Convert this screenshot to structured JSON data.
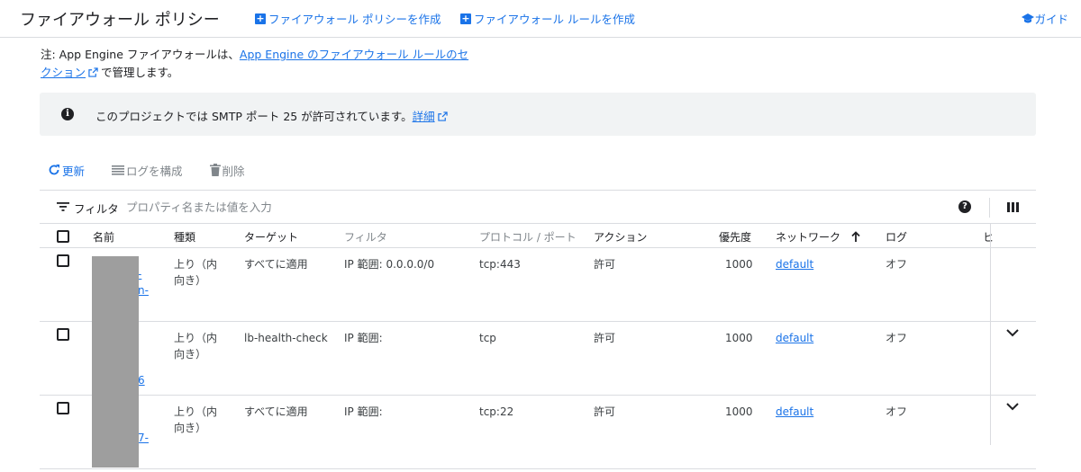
{
  "header": {
    "title": "ファイアウォール ポリシー",
    "create_policy": "ファイアウォール ポリシーを作成",
    "create_rule": "ファイアウォール ルールを作成",
    "guide": "ガイド"
  },
  "note": {
    "prefix": "注: App Engine ファイアウォールは、",
    "link": "App Engine のファイアウォール ルールのセクション",
    "suffix": "で管理します。"
  },
  "banner": {
    "text": "このプロジェクトでは SMTP ポート 25 が許可されています。",
    "link": "詳細"
  },
  "toolbar": {
    "refresh": "更新",
    "configure_logs": "ログを構成",
    "delete": "削除"
  },
  "filter": {
    "label": "フィルタ",
    "placeholder": "プロパティ名または値を入力"
  },
  "table": {
    "columns": {
      "name": "名前",
      "type": "種類",
      "targets": "ターゲット",
      "filter": "フィルタ",
      "protocol": "プロトコル / ポート",
      "action": "アクション",
      "priority": "優先度",
      "network": "ネットワーク",
      "logs": "ログ",
      "hits": "ヒ"
    },
    "rows": [
      {
        "name_frag": [
          "-",
          "n-"
        ],
        "type_line1": "上り（内",
        "type_line2": "向き）",
        "targets": "すべてに適用",
        "filter": "IP 範囲: 0.0.0.0/0",
        "protocol": "tcp:443",
        "action": "許可",
        "priority": "1000",
        "network": "default",
        "logs": "オフ"
      },
      {
        "name_frag": [
          "6"
        ],
        "type_line1": "上り（内",
        "type_line2": "向き）",
        "targets": "lb-health-check",
        "filter": "IP 範囲:",
        "protocol": "tcp",
        "action": "許可",
        "priority": "1000",
        "network": "default",
        "logs": "オフ"
      },
      {
        "name_frag": [
          "7-"
        ],
        "type_line1": "上り（内",
        "type_line2": "向き）",
        "targets": "すべてに適用",
        "filter": "IP 範囲:",
        "protocol": "tcp:22",
        "action": "許可",
        "priority": "1000",
        "network": "default",
        "logs": "オフ"
      }
    ]
  },
  "colors": {
    "accent": "#1a73e8",
    "banner_bg": "#f1f3f4",
    "border": "#dadce0",
    "redaction": "#9e9e9e"
  }
}
